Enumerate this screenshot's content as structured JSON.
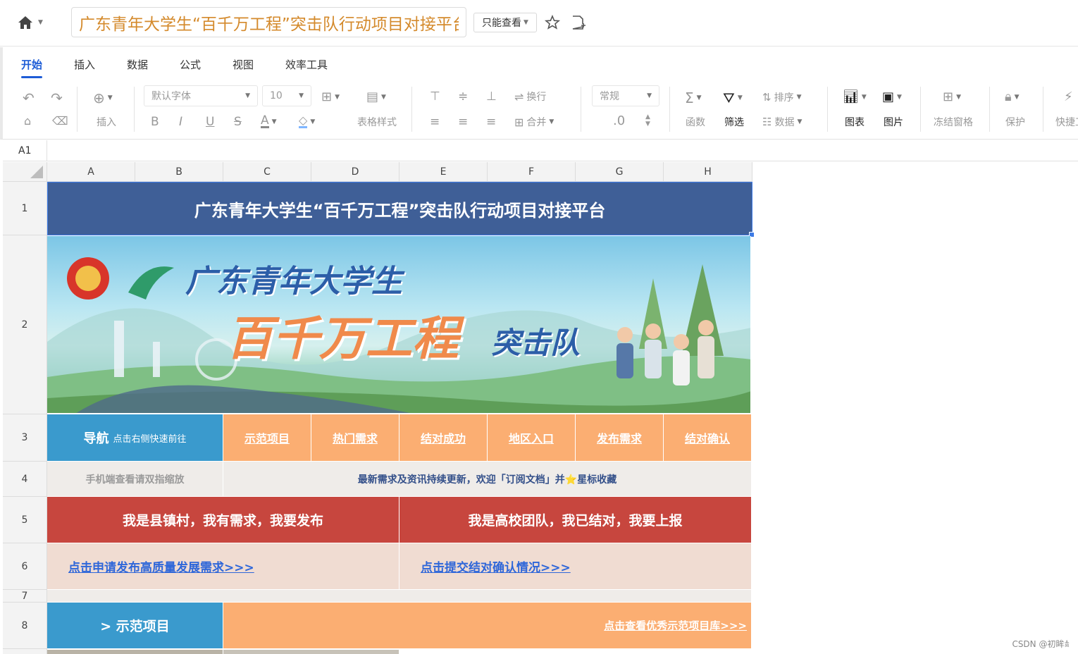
{
  "doc": {
    "title": "广东青年大学生“百千万工程”突击队行动项目对接平台",
    "permission_label": "只能查看"
  },
  "tabs": [
    "开始",
    "插入",
    "数据",
    "公式",
    "视图",
    "效率工具"
  ],
  "toolbar": {
    "insert": "插入",
    "font": "默认字体",
    "font_size": "10",
    "table_style": "表格样式",
    "wrap": "换行",
    "merge": "合并",
    "number_format": "常规",
    "decimal": ".0",
    "function": "函数",
    "filter": "筛选",
    "sort": "排序",
    "data": "数据",
    "chart": "图表",
    "image": "图片",
    "freeze": "冻结窗格",
    "protect": "保护",
    "quick": "快捷工"
  },
  "formula_bar": {
    "cell_ref": "A1"
  },
  "columns": [
    "A",
    "B",
    "C",
    "D",
    "E",
    "F",
    "G",
    "H"
  ],
  "rows": [
    "1",
    "2",
    "3",
    "4",
    "5",
    "6",
    "7",
    "8"
  ],
  "sheet": {
    "r1_title": "广东青年大学生“百千万工程”突击队行动项目对接平台",
    "banner": {
      "line1": "广东青年大学生",
      "line2": "百千万工程",
      "line3": "突击队"
    },
    "nav_title": "导航",
    "nav_sub": "点击右侧快速前往",
    "nav_links": [
      "示范项目",
      "热门需求",
      "结对成功",
      "地区入口",
      "发布需求",
      "结对确认"
    ],
    "mobile_hint": "手机端查看请双指缩放",
    "notice": "最新需求及资讯持续更新，欢迎「订阅文档」并⭐星标收藏",
    "left_header": "我是县镇村，我有需求，我要发布",
    "right_header": "我是高校团队，我已结对，我要上报",
    "left_link": "点击申请发布高质量发展需求>>>",
    "right_link": "点击提交结对确认情况>>>",
    "section_title": "> 示范项目",
    "section_link": "点击查看优秀示范项目库>>>"
  },
  "watermark": "CSDN @初眸𖠋"
}
